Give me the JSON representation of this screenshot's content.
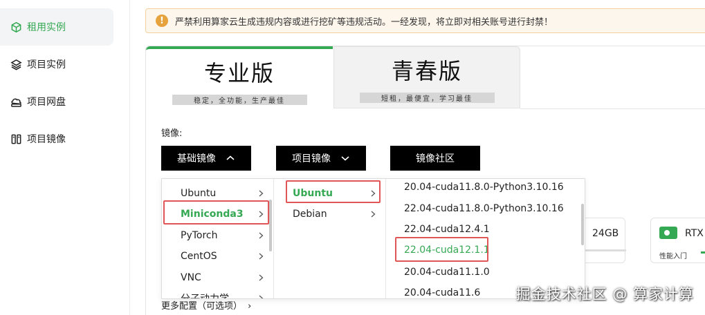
{
  "sidebar": {
    "items": [
      {
        "label": "租用实例",
        "icon": "cube-icon",
        "active": true
      },
      {
        "label": "项目实例",
        "icon": "layers-icon",
        "active": false
      },
      {
        "label": "项目网盘",
        "icon": "cloud-drive-icon",
        "active": false
      },
      {
        "label": "项目镜像",
        "icon": "mirror-icon",
        "active": false
      }
    ]
  },
  "warning": {
    "icon": "!",
    "text": "严禁利用算家云生成违规内容或进行挖矿等违规活动。一经发现，将立即对相关账号进行封禁！"
  },
  "tabs": {
    "pro": {
      "title": "专业版",
      "subtitle": "稳定，全功能，生产最佳"
    },
    "youth": {
      "title": "青春版",
      "subtitle": "短租，最便宜，学习最佳"
    }
  },
  "mirror": {
    "label": "镜像:",
    "base_button": "基础镜像",
    "project_button": "项目镜像",
    "community_button": "镜像社区"
  },
  "cascader": {
    "col1": [
      "Ubuntu",
      "Miniconda3",
      "PyTorch",
      "CentOS",
      "VNC",
      "分子动力学"
    ],
    "col2": [
      "Ubuntu",
      "Debian"
    ],
    "col3": [
      "20.04-cuda11.8.0-Python3.10.16",
      "22.04-cuda11.8.0-Python3.10.16",
      "22.04-cuda12.4.1",
      "22.04-cuda12.1.1",
      "20.04-cuda11.1.0",
      "20.04-cuda11.6"
    ]
  },
  "cards": {
    "memory": "24GB",
    "gpu_name": "RTX",
    "gpu_tier": "性能入门"
  },
  "more_config": "更多配置（可选项）",
  "watermark": "掘金技术社区 @ 算家计算",
  "colors": {
    "accent": "#35a853",
    "highlight": "#e25556",
    "warning_bg": "#fdf6ec"
  }
}
